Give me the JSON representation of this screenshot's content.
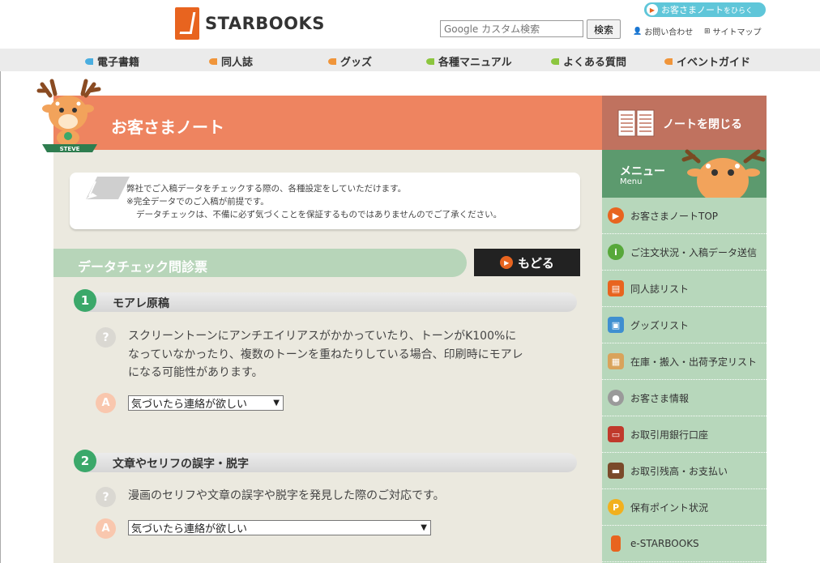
{
  "brand": {
    "name": "STARBOOKS"
  },
  "header": {
    "note_open": {
      "main": "お客さまノート",
      "sub": "をひらく"
    },
    "search_placeholder": "Google カスタム検索",
    "search_button": "検索",
    "contact": "お問い合わせ",
    "sitemap": "サイトマップ"
  },
  "nav": [
    {
      "label": "電子書籍",
      "color": "#4aaee0"
    },
    {
      "label": "同人誌",
      "color": "#f0953a"
    },
    {
      "label": "グッズ",
      "color": "#f0953a"
    },
    {
      "label": "各種マニュアル",
      "color": "#8cc63f"
    },
    {
      "label": "よくある質問",
      "color": "#8cc63f"
    },
    {
      "label": "イベントガイド",
      "color": "#f0953a"
    }
  ],
  "banner": {
    "title": "お客さまノート",
    "mascot_label": "STEVE"
  },
  "intro": {
    "line1": "弊社でご入稿データをチェックする際の、各種設定をしていただけます。",
    "line2": "※完全データでのご入稿が前提です。",
    "line3": "データチェックは、不備に必ず気づくことを保証するものではありませんのでご了承ください。"
  },
  "section": {
    "title": "データチェック問診票",
    "back_button": "もどる"
  },
  "questions": [
    {
      "num": "1",
      "title": "モアレ原稿",
      "q_mark": "?",
      "text_lines": [
        "スクリーントーンにアンチエイリアスがかかっていたり、トーンがK100%に",
        "なっていなかったり、複数のトーンを重ねたりしている場合、印刷時にモアレ",
        "になる可能性があります。"
      ],
      "a_mark": "A",
      "answer": "気づいたら連絡が欲しい"
    },
    {
      "num": "2",
      "title": "文章やセリフの誤字・脱字",
      "q_mark": "?",
      "text_lines": [
        "漫画のセリフや文章の誤字や脱字を発見した際のご対応です。"
      ],
      "a_mark": "A",
      "answer": "気づいたら連絡が欲しい"
    }
  ],
  "sidebar": {
    "close_label": "ノートを閉じる",
    "menu_title": "メニュー",
    "menu_sub": "Menu",
    "items": [
      {
        "label": "お客さまノートTOP",
        "icon": "arrow-circle-icon",
        "color": "#e8641f"
      },
      {
        "label": "ご注文状況・入稿データ送信",
        "icon": "info-icon",
        "color": "#57a83a"
      },
      {
        "label": "同人誌リスト",
        "icon": "book-icon",
        "color": "#e8641f"
      },
      {
        "label": "グッズリスト",
        "icon": "cubes-icon",
        "color": "#3f8fd0"
      },
      {
        "label": "在庫・搬入・出荷予定リスト",
        "icon": "box-icon",
        "color": "#d9a35b"
      },
      {
        "label": "お客さま情報",
        "icon": "user-icon",
        "color": "#9a9a9a"
      },
      {
        "label": "お取引用銀行口座",
        "icon": "bank-card-icon",
        "color": "#c0392b"
      },
      {
        "label": "お取引残高・お支払い",
        "icon": "wallet-icon",
        "color": "#7a4a2a"
      },
      {
        "label": "保有ポイント状況",
        "icon": "point-coin-icon",
        "color": "#f2b01e"
      },
      {
        "label": "e-STARBOOKS",
        "icon": "ebook-icon",
        "color": "#e8641f"
      }
    ]
  }
}
